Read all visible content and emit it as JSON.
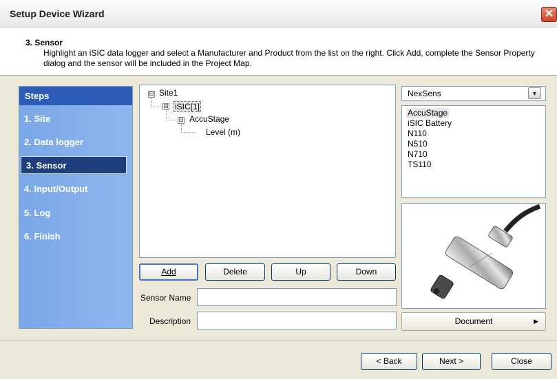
{
  "window": {
    "title": "Setup Device Wizard",
    "close_glyph": "✕"
  },
  "header": {
    "step_title": "3. Sensor",
    "desc_line1": "Highlight an iSIC data logger and select a Manufacturer and Product from the list on the right. Click Add, complete the Sensor Property",
    "desc_line2": "dialog and the sensor will be included in the Project Map."
  },
  "steps": {
    "heading": "Steps",
    "items": [
      {
        "label": "1. Site"
      },
      {
        "label": "2. Data logger"
      },
      {
        "label": "3. Sensor"
      },
      {
        "label": "4. Input/Output"
      },
      {
        "label": "5. Log"
      },
      {
        "label": "6. Finish"
      }
    ],
    "active_index": 2
  },
  "tree": {
    "nodes": [
      {
        "label": "Site1",
        "expander": "⊟"
      },
      {
        "label": "iSIC[1]",
        "expander": "⊟"
      },
      {
        "label": "AccuStage",
        "expander": "⊟"
      },
      {
        "label": "Level (m)"
      }
    ]
  },
  "actions": {
    "add": "Add",
    "delete": "Delete",
    "up": "Up",
    "down": "Down"
  },
  "fields": {
    "sensor_name_label": "Sensor Name",
    "sensor_name_value": "",
    "description_label": "Description",
    "description_value": ""
  },
  "manufacturer": {
    "selected": "NexSens",
    "dropdown_glyph": "▼"
  },
  "products": [
    "AccuStage",
    "iSIC Battery",
    "N110",
    "N510",
    "N710",
    "TS110"
  ],
  "product_selected_index": 0,
  "document_button": {
    "label": "Document",
    "arrow": "▶"
  },
  "footer": {
    "back": "< Back",
    "next": "Next >",
    "close": "Close"
  },
  "colors": {
    "steps_active_bg": "#1f3f7c",
    "steps_panel": "#85b0ec",
    "steps_heading": "#2d5db6"
  }
}
